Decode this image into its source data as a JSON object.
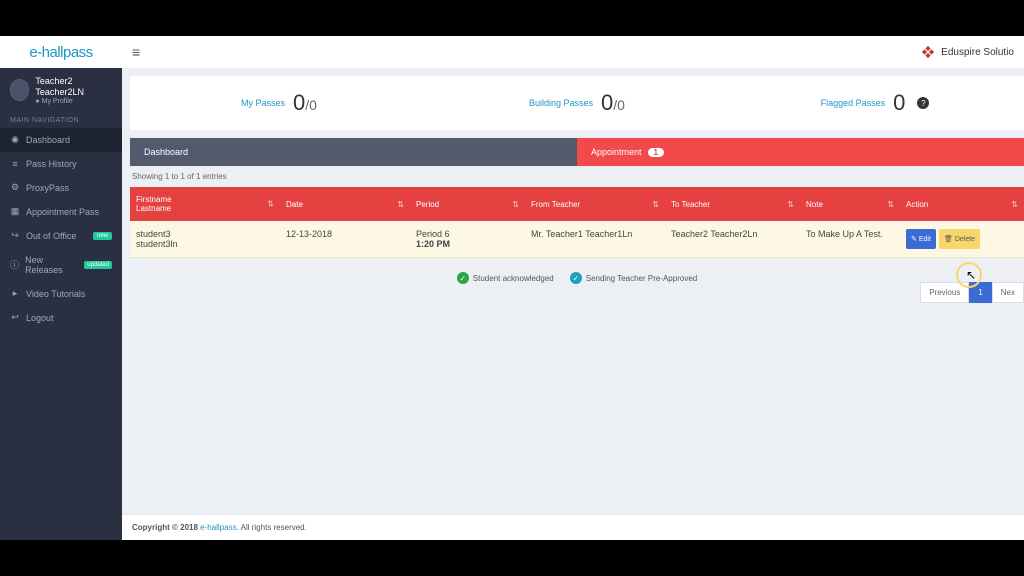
{
  "logo": "e-hallpass",
  "brand_right": "Eduspire Solutio",
  "profile": {
    "name": "Teacher2 Teacher2LN",
    "link": "My Profile"
  },
  "nav": {
    "header": "MAIN NAVIGATION",
    "items": [
      {
        "label": "Dashboard",
        "active": true
      },
      {
        "label": "Pass History"
      },
      {
        "label": "ProxyPass"
      },
      {
        "label": "Appointment Pass"
      },
      {
        "label": "Out of Office",
        "badge": "new"
      },
      {
        "label": "New Releases",
        "badge": "updated"
      },
      {
        "label": "Video Tutorials"
      },
      {
        "label": "Logout"
      }
    ]
  },
  "stats": {
    "my_passes": {
      "label": "My Passes",
      "num": "0",
      "denom": "/0"
    },
    "building_passes": {
      "label": "Building Passes",
      "num": "0",
      "denom": "/0"
    },
    "flagged_passes": {
      "label": "Flagged Passes",
      "num": "0"
    }
  },
  "tabs": {
    "dashboard": "Dashboard",
    "appointment": "Appointment",
    "appointment_count": "1"
  },
  "table_info": "Showing 1 to 1 of 1 entries",
  "columns": {
    "name1": "Firstname",
    "name2": "Lastname",
    "date": "Date",
    "period": "Period",
    "from": "From Teacher",
    "to": "To Teacher",
    "note": "Note",
    "action": "Action"
  },
  "row": {
    "first": "student3",
    "last": "student3ln",
    "date": "12-13-2018",
    "period": "Period 6",
    "time": "1:20 PM",
    "from": "Mr. Teacher1 Teacher1Ln",
    "to": "Teacher2 Teacher2Ln",
    "note": "To Make Up A Test.",
    "edit": "Edit",
    "delete": "Delete"
  },
  "legend": {
    "ack": "Student acknowledged",
    "pre": "Sending Teacher Pre-Approved"
  },
  "pagination": {
    "prev": "Previous",
    "page": "1",
    "next": "Nex"
  },
  "footer": {
    "copyright": "Copyright © 2018 ",
    "brand": "e-hallpass.",
    "rights": " All rights reserved."
  }
}
